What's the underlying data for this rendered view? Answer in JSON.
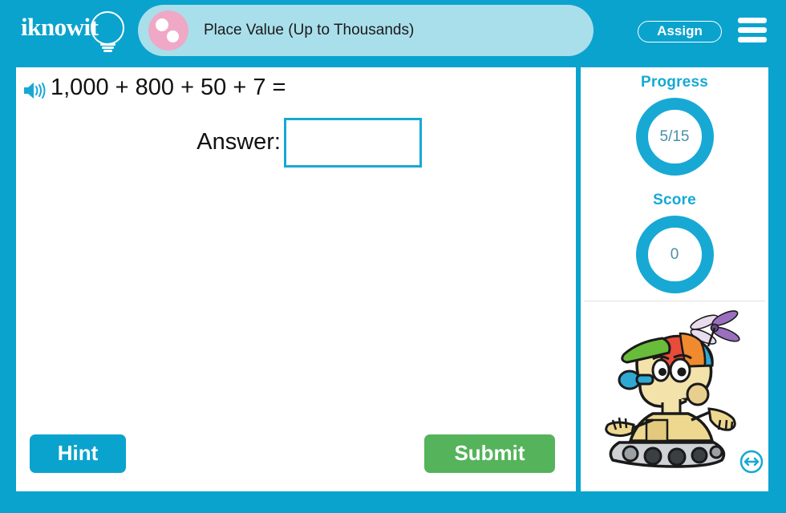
{
  "header": {
    "logo_text": "iknowit",
    "logo_icon": "lightbulb-icon",
    "title": "Place Value (Up to Thousands)",
    "title_icon": "pink-dots-icon",
    "assign_label": "Assign",
    "menu_icon": "hamburger-menu-icon"
  },
  "question": {
    "audio_icon": "speaker-icon",
    "text": "1,000 + 800 + 50 + 7 =",
    "answer_label": "Answer:",
    "answer_value": "",
    "answer_placeholder": ""
  },
  "actions": {
    "hint_label": "Hint",
    "submit_label": "Submit"
  },
  "sidebar": {
    "progress_label": "Progress",
    "progress_value": "5/15",
    "score_label": "Score",
    "score_value": "0",
    "mascot_icon": "robot-mascot-icon",
    "resize_icon": "resize-horizontal-icon"
  },
  "colors": {
    "brand_cyan": "#0aa3ce",
    "accent_cyan": "#17a9d4",
    "title_pill": "#a9dfeb",
    "title_icon_pink": "#efa8c5",
    "submit_green": "#55b35b",
    "stat_value_text": "#4b8fa8"
  }
}
